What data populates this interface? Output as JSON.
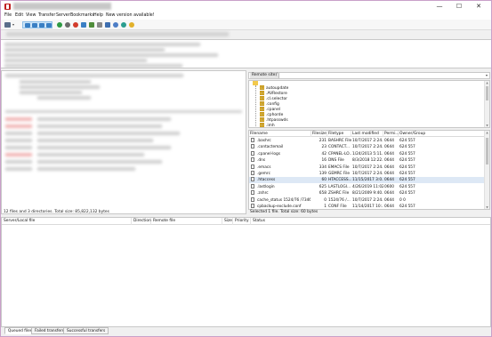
{
  "menu": [
    "File",
    "Edit",
    "View",
    "Transfer",
    "Server",
    "Bookmarks",
    "Help",
    "New version available!"
  ],
  "window_controls": {
    "minimize": "—",
    "maximize": "☐",
    "close": "✕"
  },
  "local_status": "12 files and 3 directories. Total size: 85,822,132 bytes",
  "remote": {
    "site_label": "Remote site:",
    "path": "/",
    "tree": [
      "autoupdate",
      ".AVRestore",
      ".cl.selector",
      ".config",
      ".cpanel",
      ".cphorde",
      ".htpasswds",
      ".imh"
    ],
    "columns": [
      "Filename",
      "Filesize",
      "Filetype",
      "Last modified",
      "Permi...",
      "Owner/Group"
    ],
    "files": [
      {
        "name": ".bashrc",
        "size": "231",
        "type": "BASHRC File",
        "modified": "10/7/2017 2:24...",
        "perm": "0644",
        "owner": "624 557",
        "selected": false
      },
      {
        "name": ".contactemail",
        "size": "23",
        "type": "CONTACT...",
        "modified": "10/7/2017 2:24...",
        "perm": "0644",
        "owner": "624 557",
        "selected": false
      },
      {
        "name": ".cpanel-logs",
        "size": "42",
        "type": "CPANEL-LO...",
        "modified": "1/24/2013 5:11...",
        "perm": "0644",
        "owner": "624 557",
        "selected": false
      },
      {
        "name": ".dns",
        "size": "16",
        "type": "DNS File",
        "modified": "8/3/2018 12:22...",
        "perm": "0644",
        "owner": "624 557",
        "selected": false
      },
      {
        "name": ".emacs",
        "size": "334",
        "type": "EMACS File",
        "modified": "10/7/2017 2:24...",
        "perm": "0644",
        "owner": "624 557",
        "selected": false
      },
      {
        "name": ".gemrc",
        "size": "139",
        "type": "GEMRC File",
        "modified": "10/7/2017 2:24...",
        "perm": "0644",
        "owner": "624 557",
        "selected": false
      },
      {
        "name": ".htaccess",
        "size": "60",
        "type": "HTACCESS...",
        "modified": "11/15/2017 3:0...",
        "perm": "0644",
        "owner": "624 557",
        "selected": true
      },
      {
        "name": ".lastlogin",
        "size": "625",
        "type": "LASTLOGI...",
        "modified": "4/26/2019 11:02...",
        "perm": "0600",
        "owner": "624 557",
        "selected": false
      },
      {
        "name": ".zshrc",
        "size": "658",
        "type": "ZSHRC File",
        "modified": "8/21/2009 9:40...",
        "perm": "0644",
        "owner": "624 557",
        "selected": false
      },
      {
        "name": "cache_status 1524/76 /7346",
        "size": "0",
        "type": "1524/76 /...",
        "modified": "10/7/2017 2:24...",
        "perm": "0644",
        "owner": "0 0",
        "selected": false
      },
      {
        "name": "cpbackup-exclude.conf",
        "size": "1",
        "type": "CONF File",
        "modified": "11/14/2017 10:...",
        "perm": "0644",
        "owner": "624 557",
        "selected": false
      }
    ],
    "status": "Selected 1 file. Total size: 60 bytes"
  },
  "queue": {
    "columns": [
      "Server/Local file",
      "Direction",
      "Remote file",
      "Size",
      "Priority",
      "Status"
    ],
    "tabs": [
      "Queued files",
      "Failed transfers",
      "Successful transfers"
    ]
  }
}
